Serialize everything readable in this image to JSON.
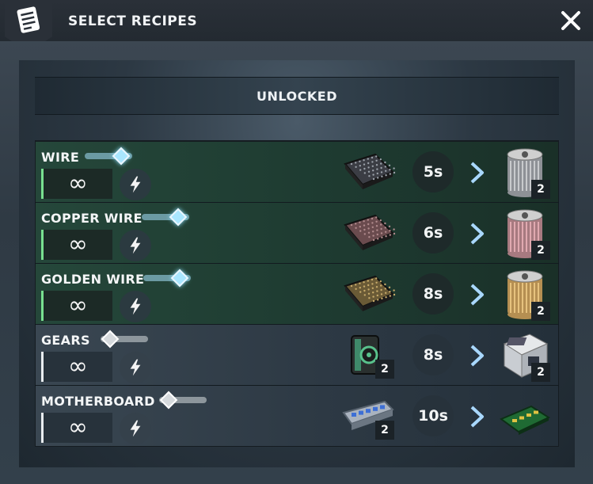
{
  "window": {
    "title": "SELECT RECIPES",
    "close_icon": "close-icon",
    "title_icon": "recipe-list-icon"
  },
  "section": {
    "title": "UNLOCKED"
  },
  "colors": {
    "unlocked_row": "#25473a",
    "locked_row": "#3a4752",
    "accent_green": "#78e08f",
    "toggle_on": "#a9e6ff"
  },
  "recipes": [
    {
      "name": "WIRE",
      "enabled": true,
      "quantity": "∞",
      "time": "5s",
      "ingredient": {
        "icon": "iron-plate-icon",
        "count": ""
      },
      "output": {
        "icon": "wire-spool-icon",
        "count": "2"
      }
    },
    {
      "name": "COPPER WIRE",
      "enabled": true,
      "quantity": "∞",
      "time": "6s",
      "ingredient": {
        "icon": "copper-plate-icon",
        "count": ""
      },
      "output": {
        "icon": "copper-wire-spool-icon",
        "count": "2"
      }
    },
    {
      "name": "GOLDEN WIRE",
      "enabled": true,
      "quantity": "∞",
      "time": "8s",
      "ingredient": {
        "icon": "gold-plate-icon",
        "count": ""
      },
      "output": {
        "icon": "golden-wire-spool-icon",
        "count": "2"
      }
    },
    {
      "name": "GEARS",
      "enabled": false,
      "quantity": "∞",
      "time": "8s",
      "ingredient": {
        "icon": "gear-machine-part-icon",
        "count": "2"
      },
      "output": {
        "icon": "gearbox-block-icon",
        "count": "2"
      }
    },
    {
      "name": "MOTHERBOARD",
      "enabled": false,
      "quantity": "∞",
      "time": "10s",
      "ingredient": {
        "icon": "circuit-tray-icon",
        "count": "2"
      },
      "output": {
        "icon": "motherboard-icon",
        "count": ""
      }
    }
  ]
}
